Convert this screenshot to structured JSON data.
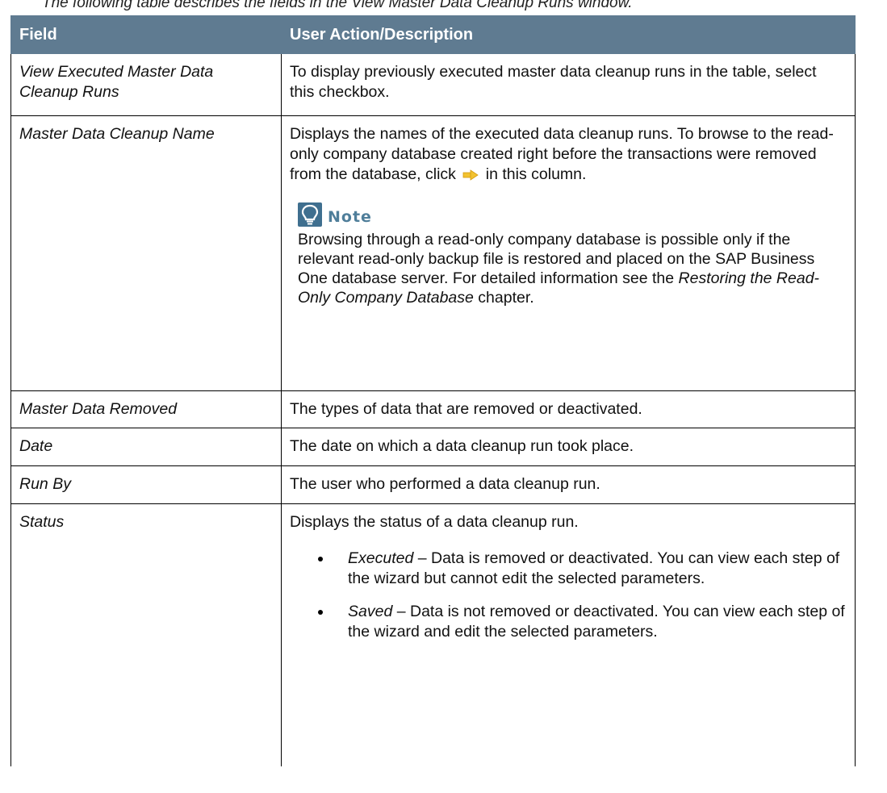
{
  "caption": "The following table describes the fields in the View Master Data Cleanup Runs window.",
  "table": {
    "headers": [
      "Field",
      "User Action/Description"
    ],
    "rows": {
      "view_runs": {
        "field": "View Executed Master Data Cleanup Runs",
        "desc": "To display previously executed master data cleanup runs in the table, select this checkbox."
      },
      "cleanup_name": {
        "field": "Master Data Cleanup Name",
        "desc_before": "Displays the names of the executed data cleanup runs. To browse to the read-only company database created right before the transactions were removed from the database, click",
        "desc_after": "in this column.",
        "link_icon": "yellow-arrow-icon",
        "note": {
          "icon": "lightbulb-icon",
          "title": "Note",
          "text_before": "Browsing through a read-only company database is possible only if the relevant read-only backup file is restored and placed on the SAP Business One database server. For detailed information see the",
          "text_italic": "Restoring the Read-Only Company Database",
          "text_after": "chapter."
        }
      },
      "removed": {
        "field": "Master Data Removed",
        "desc": "The types of data that are removed or deactivated."
      },
      "date": {
        "field": "Date",
        "desc": "The date on which a data cleanup run took place."
      },
      "run_by": {
        "field": "Run By",
        "desc": "The user who performed a data cleanup run."
      },
      "status": {
        "field": "Status",
        "desc": "Displays the status of a data cleanup run.",
        "items": [
          {
            "term": "Executed",
            "text": "– Data is removed or deactivated. You can view each step of the wizard but cannot edit the selected parameters."
          },
          {
            "term": "Saved",
            "text": "– Data is not removed or deactivated. You can view each step of the wizard and edit the selected parameters."
          }
        ]
      }
    }
  },
  "colors": {
    "header_bg": "#5f7b91",
    "note_title": "#4f7e9a",
    "icon_blue": "#3f6f8f",
    "arrow_yellow": "#f2c230"
  }
}
